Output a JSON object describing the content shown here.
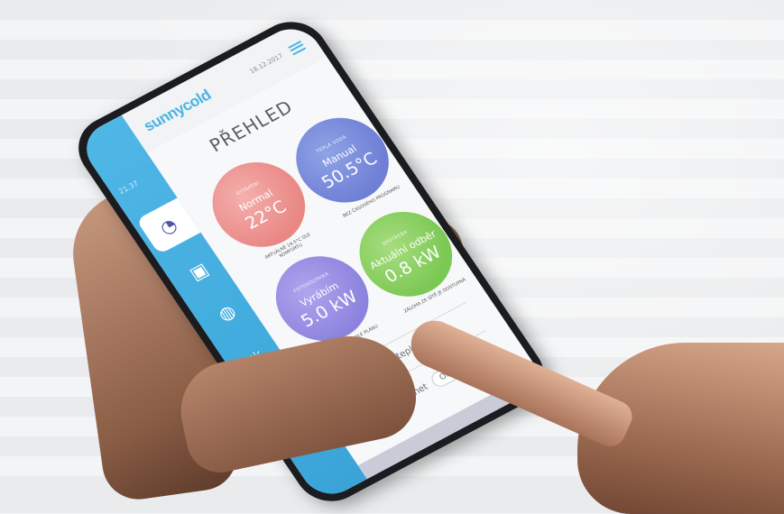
{
  "app": {
    "logo": "sunnycold",
    "date": "18.12.2017",
    "sidebar_number": "21.37"
  },
  "screen": {
    "title": "PŘEHLED"
  },
  "sidebar": {
    "items": [
      {
        "icon": "overview-icon"
      },
      {
        "icon": "tank-icon"
      },
      {
        "icon": "water-drop-icon"
      },
      {
        "icon": "sun-icon"
      },
      {
        "icon": "power-icon"
      }
    ]
  },
  "cards": [
    {
      "small": "VYTÁPĚNÍ",
      "label": "Normal",
      "value": "22°C",
      "note": "AKTUÁLNĚ 19.5°C DLE KOMFORTU",
      "color": "#e98784"
    },
    {
      "small": "TEPLÁ VODA",
      "label": "Manual",
      "value": "50.5°C",
      "note": "BEZ ČASOVÉHO PROGRAMU",
      "color": "#6f7fd6"
    },
    {
      "small": "FOTOVOLTAIKA",
      "label": "Vyrábím",
      "value": "5.0 kW",
      "note": "BATERIE: 58 % DLE PLÁNU",
      "color": "#8c83de"
    },
    {
      "small": "SPOTŘEBA",
      "label": "Aktuální odběr",
      "value": "0.8 kW",
      "note": "ZÁLOHA ZE SÍTĚ JE DOSTUPNÁ",
      "color": "#7bc853"
    }
  ],
  "footer": {
    "outdoor_temp": "Venkovní teplota 8.5°C",
    "internet_label": "Internet",
    "internet_status": "OK"
  }
}
